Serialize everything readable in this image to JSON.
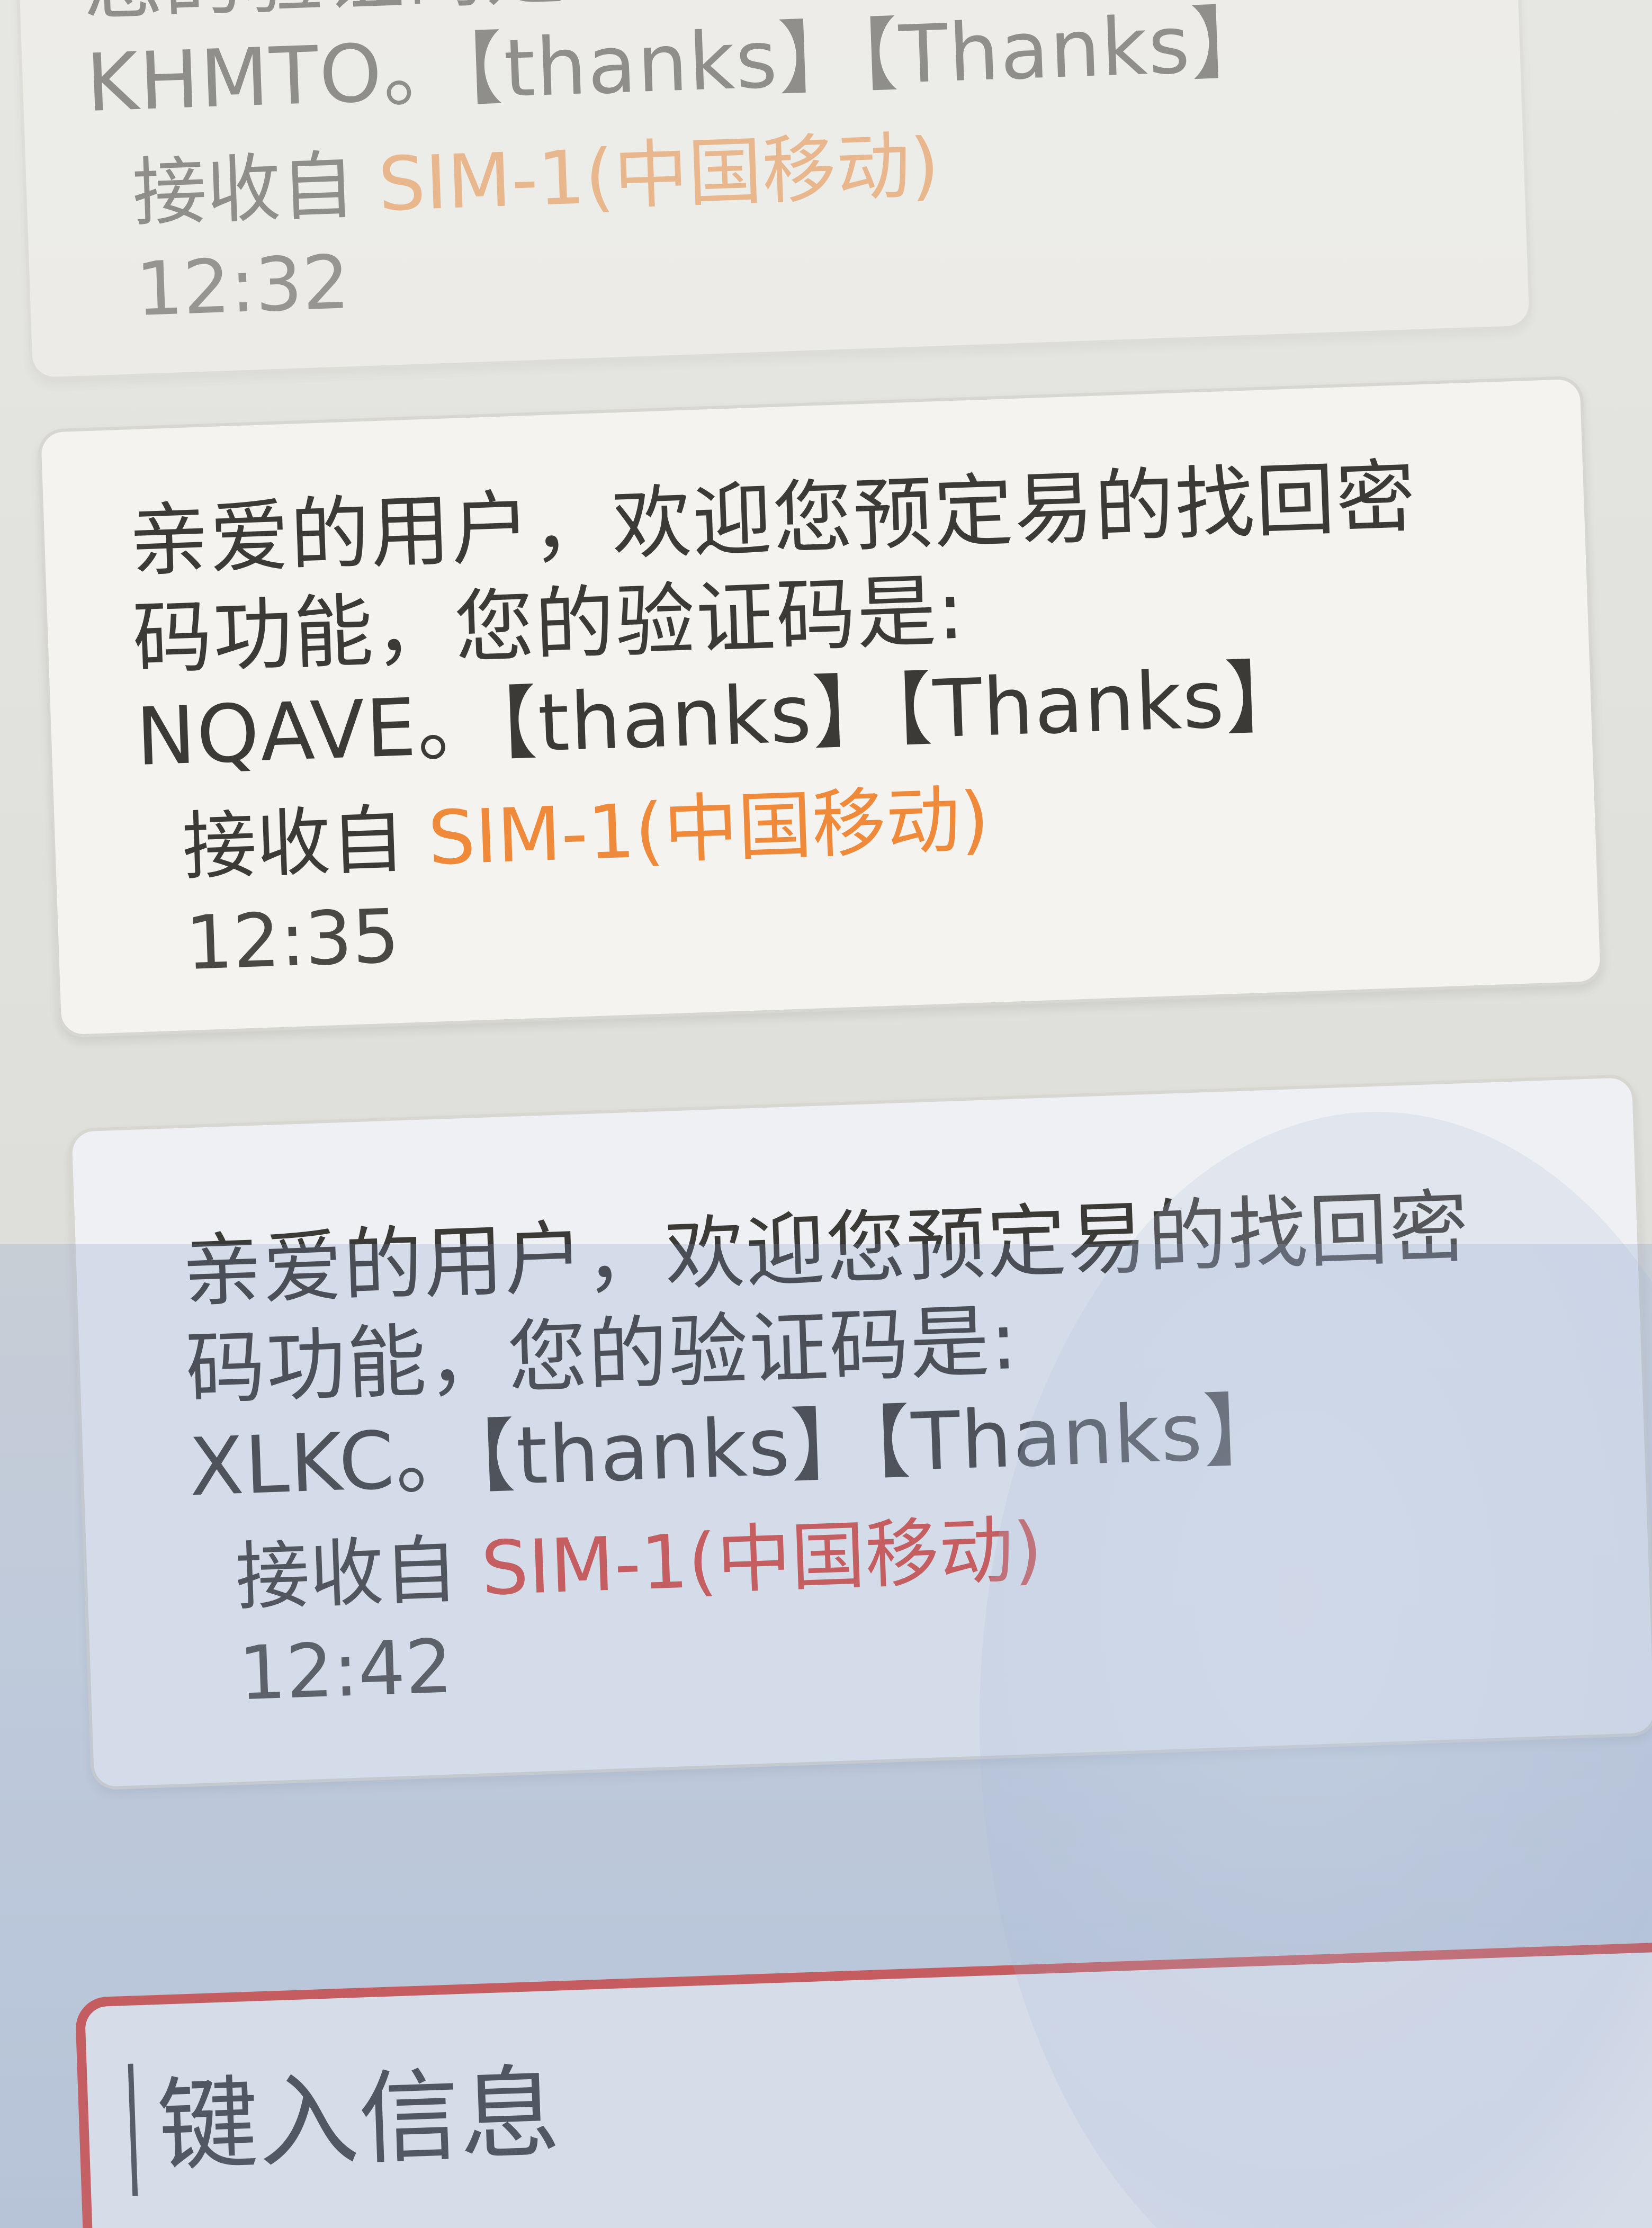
{
  "messages": [
    {
      "body": "您的验证码是:\nKHMTO。【thanks】【Thanks】",
      "received_label": "接收自",
      "sim": "SIM-1(中国移动)",
      "time": "12:32"
    },
    {
      "body": "亲爱的用户，欢迎您预定易的找回密\n码功能，您的验证码是:\nNQAVE。【thanks】【Thanks】",
      "received_label": "接收自",
      "sim": "SIM-1(中国移动)",
      "time": "12:35"
    },
    {
      "body": "亲爱的用户，欢迎您预定易的找回密\n码功能，您的验证码是:\nXLKC。【thanks】【Thanks】",
      "received_label": "接收自",
      "sim": "SIM-1(中国移动)",
      "time": "12:42"
    }
  ],
  "compose": {
    "placeholder": "键入信息"
  },
  "colors": {
    "sim_label_1": "#ee8a3a",
    "sim_label_2": "#d9463a",
    "input_border": "#d8362a",
    "bubble_bg": "#f4f3ef"
  }
}
